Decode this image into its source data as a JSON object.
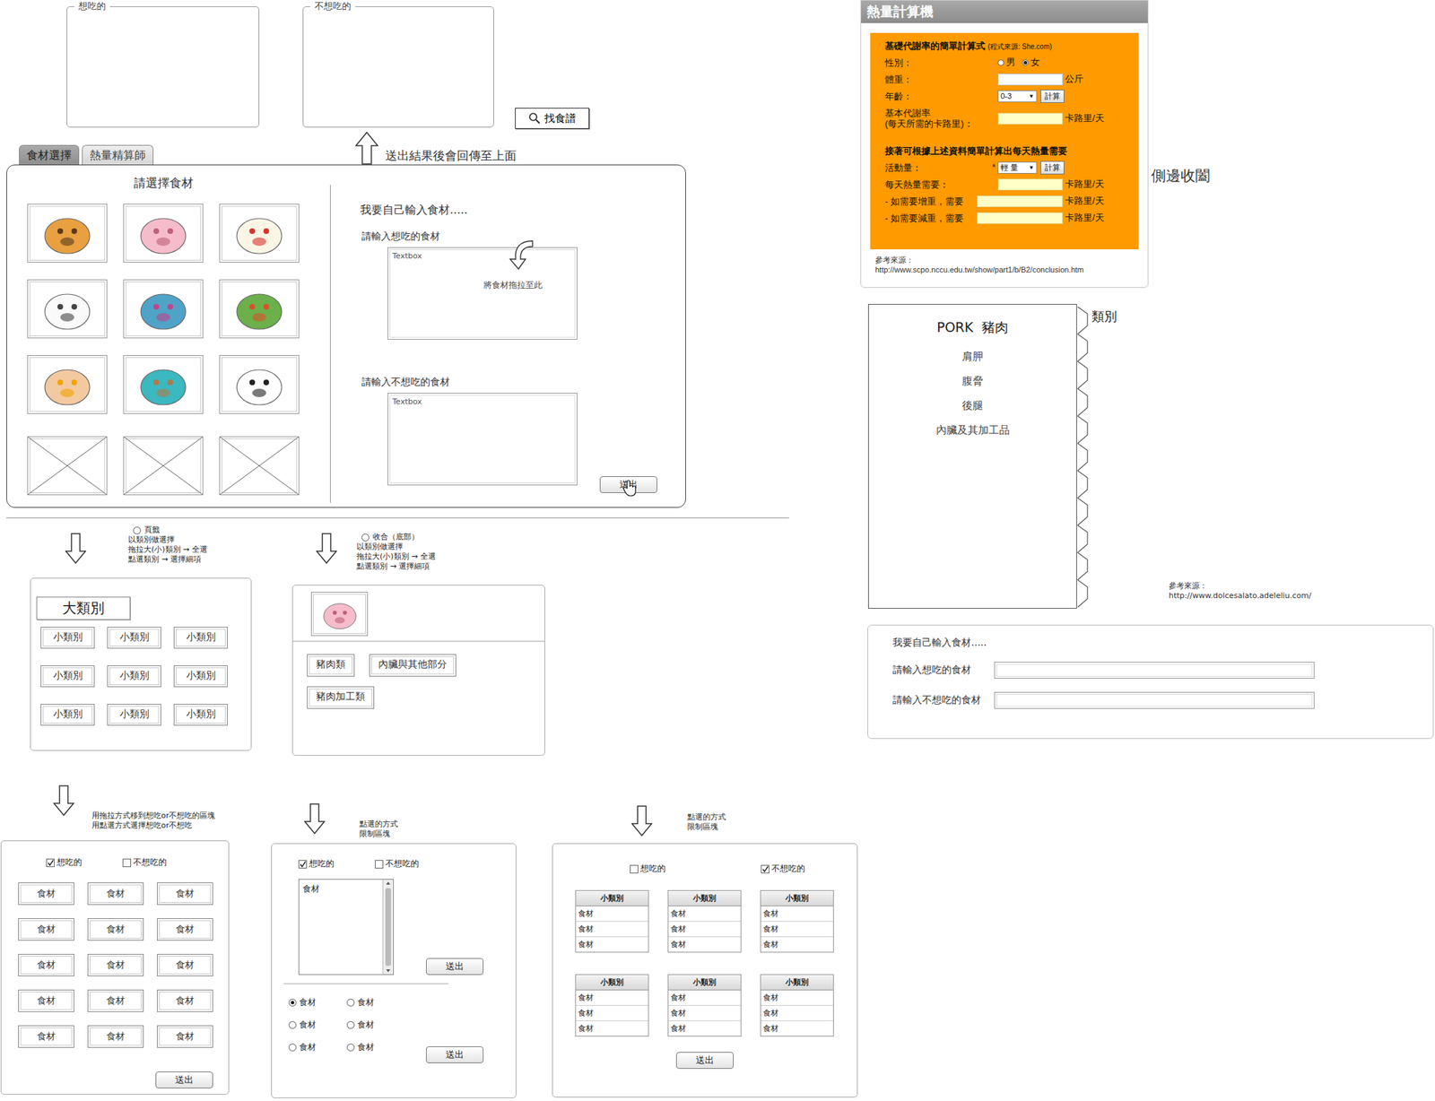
{
  "result_boxes": [
    {
      "label": "想吃的"
    },
    {
      "label": "不想吃的"
    }
  ],
  "find_recipe": {
    "label": "找食譜"
  },
  "return_note": "送出結果後會回傳至上面",
  "tabs": [
    {
      "label": "食材選擇",
      "selected": true
    },
    {
      "label": "熱量精算師",
      "selected": false
    }
  ],
  "ingredient_panel": {
    "title": "請選擇食材",
    "tiles": [
      {
        "kind": "image"
      },
      {
        "kind": "image"
      },
      {
        "kind": "image"
      },
      {
        "kind": "image"
      },
      {
        "kind": "image"
      },
      {
        "kind": "image"
      },
      {
        "kind": "image"
      },
      {
        "kind": "image"
      },
      {
        "kind": "image"
      },
      {
        "kind": "placeholder"
      },
      {
        "kind": "placeholder"
      },
      {
        "kind": "placeholder"
      }
    ],
    "custom": {
      "title": "我要自己輸入食材.....",
      "want_label": "請輸入想吃的食材",
      "want_placeholder": "Textbox",
      "drag_hint": "將食材拖拉至此",
      "not_want_label": "請輸入不想吃的食材",
      "not_want_placeholder": "Textbox",
      "submit": "送出"
    }
  },
  "option_tabbed": {
    "radio": {
      "label": "頁籤",
      "selected": false
    },
    "notes": [
      "以類別做選擇",
      "拖拉大(小)類別 → 全選",
      "點選類別 → 選擇細項"
    ],
    "category": "大類別",
    "subcategories": [
      "小類別",
      "小類別",
      "小類別",
      "小類別",
      "小類別",
      "小類別",
      "小類別",
      "小類別",
      "小類別"
    ]
  },
  "option_collapse": {
    "radio": {
      "label": "收合（底部）",
      "selected": false
    },
    "notes": [
      "以類別做選擇",
      "拖拉大(小)類別 → 全選",
      "點選類別 → 選擇細項"
    ],
    "subcategories": [
      "豬肉類",
      "內臟與其他部分",
      "豬肉加工類"
    ]
  },
  "select_drag": {
    "notes": [
      "用拖拉方式移到想吃or不想吃的區塊",
      "用點選方式選擇想吃or不想吃"
    ],
    "toggles": [
      {
        "label": "想吃的",
        "checked": true
      },
      {
        "label": "不想吃的",
        "checked": false
      }
    ],
    "items": [
      "食材",
      "食材",
      "食材",
      "食材",
      "食材",
      "食材",
      "食材",
      "食材",
      "食材",
      "食材",
      "食材",
      "食材",
      "食材",
      "食材",
      "食材"
    ],
    "submit": "送出"
  },
  "select_list": {
    "notes": [
      "點選的方式",
      "限制區塊"
    ],
    "toggles": [
      {
        "label": "想吃的",
        "checked": true
      },
      {
        "label": "不想吃的",
        "checked": false
      }
    ],
    "list_items": [
      "食材"
    ],
    "list_submit": "送出",
    "radios": [
      {
        "label": "食材",
        "selected": true
      },
      {
        "label": "食材",
        "selected": false
      },
      {
        "label": "食材",
        "selected": false
      },
      {
        "label": "食材",
        "selected": false
      },
      {
        "label": "食材",
        "selected": false
      },
      {
        "label": "食材",
        "selected": false
      }
    ],
    "submit": "送出"
  },
  "select_table": {
    "notes": [
      "點選的方式",
      "限制區塊"
    ],
    "toggles": [
      {
        "label": "想吃的",
        "checked": false
      },
      {
        "label": "不想吃的",
        "checked": true
      }
    ],
    "tables": [
      {
        "header": "小類別",
        "rows": [
          "食材",
          "食材",
          "食材"
        ]
      },
      {
        "header": "小類別",
        "rows": [
          "食材",
          "食材",
          "食材"
        ]
      },
      {
        "header": "小類別",
        "rows": [
          "食材",
          "食材",
          "食材"
        ]
      },
      {
        "header": "小類別",
        "rows": [
          "食材",
          "食材",
          "食材"
        ]
      },
      {
        "header": "小類別",
        "rows": [
          "食材",
          "食材",
          "食材"
        ]
      },
      {
        "header": "小類別",
        "rows": [
          "食材",
          "食材",
          "食材"
        ]
      }
    ],
    "submit": "送出"
  },
  "calorie_calculator": {
    "title": "熱量計算機",
    "heading": "基礎代謝率的簡單計算式",
    "source": "(程式來源: She.com)",
    "gender": {
      "label": "性別：",
      "options": [
        {
          "label": "男",
          "selected": false
        },
        {
          "label": "女",
          "selected": true
        }
      ]
    },
    "weight": {
      "label": "體重：",
      "unit": "公斤"
    },
    "age": {
      "label": "年齡：",
      "value": "0-3",
      "button": "計算"
    },
    "bmr": {
      "label": "基本代謝率",
      "sublabel": "(每天所需的卡路里)：",
      "unit": "卡路里/天"
    },
    "followup": "接著可根據上述資料簡單計算出每天熱量需要",
    "activity": {
      "label": "活動量：",
      "mark": "*",
      "value": "輕 量",
      "button": "計算"
    },
    "dropdown_icon": "▼",
    "results": [
      {
        "label": "每天熱量需要：",
        "unit": "卡路里/天"
      },
      {
        "label": "- 如需要增重，需要",
        "unit": "卡路里/天"
      },
      {
        "label": "- 如需要減重，需要",
        "unit": "卡路里/天"
      }
    ],
    "reference_label": "參考來源：",
    "reference_url": "http://www.scpo.nccu.edu.tw/show/part1/b/B2/conclusion.htm"
  },
  "side_note": "側邊收闔",
  "pork_panel": {
    "title": "PORK  豬肉",
    "cuts": [
      "肩胛",
      "腹脅",
      "後腿",
      "內臟及其加工品"
    ],
    "tab_label": "類別",
    "reference_label": "參考來源：",
    "reference_url": "http://www.dolcesalato.adeleliu.com/"
  },
  "custom_input_panel": {
    "title": "我要自己輸入食材.....",
    "fields": [
      {
        "label": "請輸入想吃的食材"
      },
      {
        "label": "請輸入不想吃的食材"
      }
    ]
  }
}
